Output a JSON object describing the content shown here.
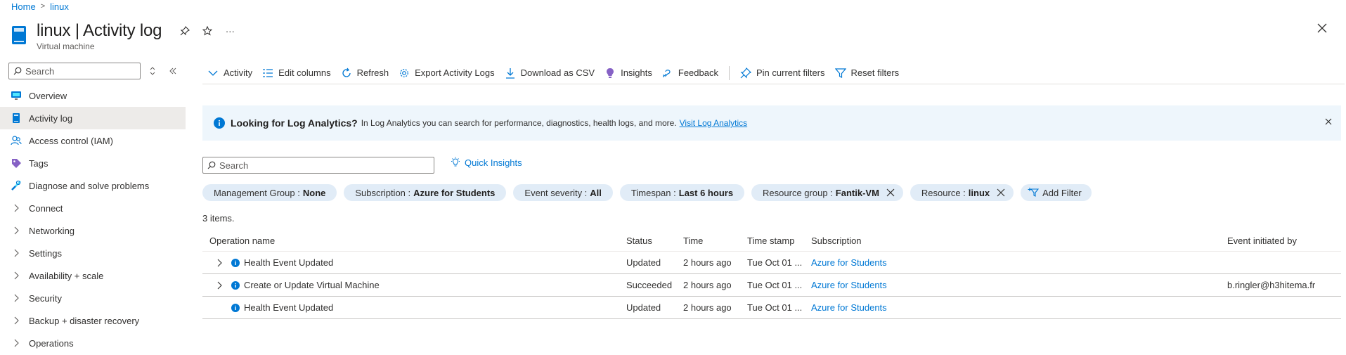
{
  "breadcrumb": {
    "home": "Home",
    "current": "linux"
  },
  "header": {
    "resource": "linux",
    "separator": " | ",
    "page": "Activity log",
    "subtitle": "Virtual machine",
    "more": "···"
  },
  "sidebar": {
    "search_placeholder": "Search",
    "items": [
      {
        "label": "Overview",
        "icon": "monitor-icon"
      },
      {
        "label": "Activity log",
        "icon": "activity-log-icon",
        "active": true
      },
      {
        "label": "Access control (IAM)",
        "icon": "people-icon"
      },
      {
        "label": "Tags",
        "icon": "tag-icon"
      },
      {
        "label": "Diagnose and solve problems",
        "icon": "wrench-icon"
      },
      {
        "label": "Connect",
        "icon": "chevron-right-icon"
      },
      {
        "label": "Networking",
        "icon": "chevron-right-icon"
      },
      {
        "label": "Settings",
        "icon": "chevron-right-icon"
      },
      {
        "label": "Availability + scale",
        "icon": "chevron-right-icon"
      },
      {
        "label": "Security",
        "icon": "chevron-right-icon"
      },
      {
        "label": "Backup + disaster recovery",
        "icon": "chevron-right-icon"
      },
      {
        "label": "Operations",
        "icon": "chevron-right-icon"
      }
    ]
  },
  "toolbar": {
    "activity": "Activity",
    "edit_columns": "Edit columns",
    "refresh": "Refresh",
    "export": "Export Activity Logs",
    "download": "Download as CSV",
    "insights": "Insights",
    "feedback": "Feedback",
    "pin_filters": "Pin current filters",
    "reset_filters": "Reset filters"
  },
  "banner": {
    "title": "Looking for Log Analytics?",
    "text": "In Log Analytics you can search for performance, diagnostics, health logs, and more.",
    "link": "Visit Log Analytics"
  },
  "filters": {
    "search_placeholder": "Search",
    "quick_insights": "Quick Insights",
    "pills": [
      {
        "label": "Management Group :",
        "value": "None"
      },
      {
        "label": "Subscription :",
        "value": "Azure for Students"
      },
      {
        "label": "Event severity :",
        "value": "All"
      },
      {
        "label": "Timespan :",
        "value": "Last 6 hours"
      },
      {
        "label": "Resource group :",
        "value": "Fantik-VM"
      },
      {
        "label": "Resource :",
        "value": "linux"
      }
    ],
    "add_filter": "Add Filter"
  },
  "results": {
    "count": "3 items.",
    "columns": [
      "Operation name",
      "Status",
      "Time",
      "Time stamp",
      "Subscription",
      "Event initiated by"
    ],
    "rows": [
      {
        "operation": "Health Event Updated",
        "status": "Updated",
        "time": "2 hours ago",
        "stamp": "Tue Oct 01 ...",
        "subscription": "Azure for Students",
        "by": ""
      },
      {
        "operation": "Create or Update Virtual Machine",
        "status": "Succeeded",
        "time": "2 hours ago",
        "stamp": "Tue Oct 01 ...",
        "subscription": "Azure for Students",
        "by": "b.ringler@h3hitema.fr"
      },
      {
        "operation": "Health Event Updated",
        "status": "Updated",
        "time": "2 hours ago",
        "stamp": "Tue Oct 01 ...",
        "subscription": "Azure for Students",
        "by": ""
      }
    ]
  },
  "colors": {
    "accent": "#0078d4",
    "banner_bg": "#eef6fc",
    "pill_bg": "#e1ecf7",
    "active_nav": "#edebe9"
  }
}
